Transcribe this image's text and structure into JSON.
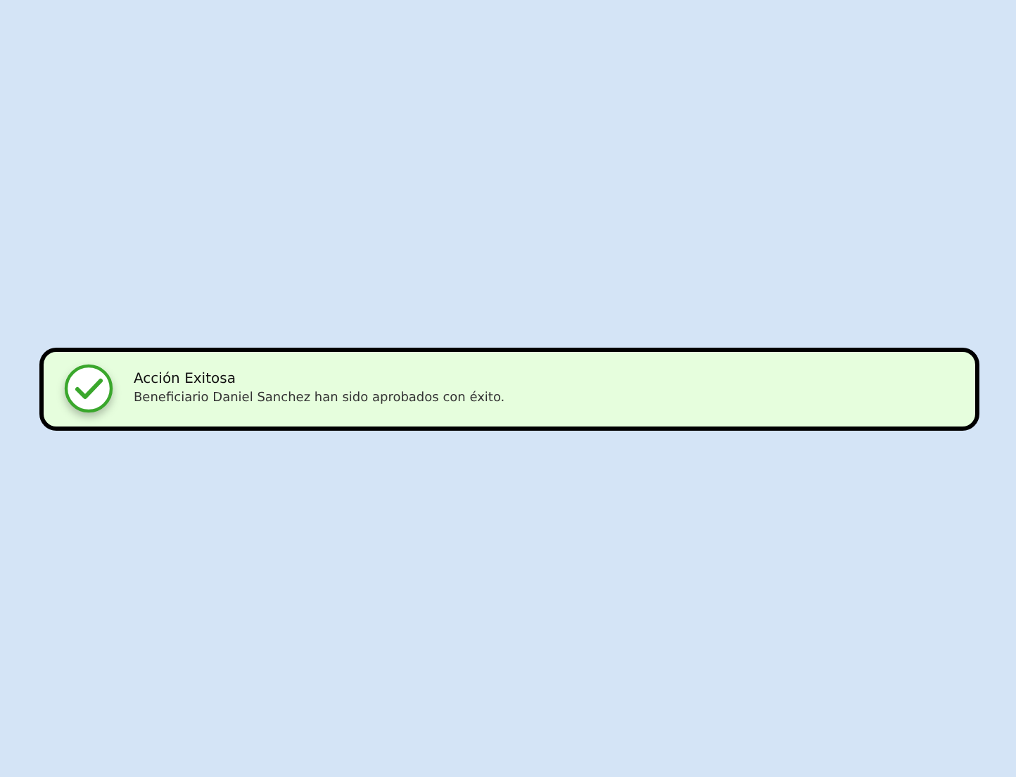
{
  "alert": {
    "kind": "success",
    "title": "Acción Exitosa",
    "message": "Beneficiario Daniel Sanchez han sido aprobados con éxito."
  }
}
